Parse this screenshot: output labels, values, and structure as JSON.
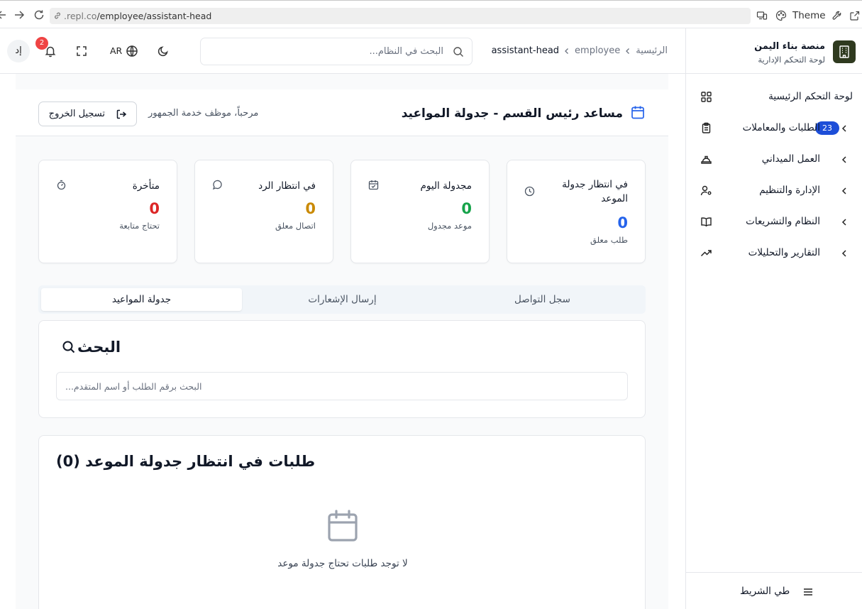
{
  "browser": {
    "url_domain": ".repl.co",
    "url_path": "/employee/assistant-head",
    "theme_label": "Theme"
  },
  "header": {
    "avatar_initials": "إد",
    "notification_count": "2",
    "language": "AR",
    "search_placeholder": "البحث في النظام...",
    "breadcrumb": [
      "الرئيسية",
      "employee",
      "assistant-head"
    ]
  },
  "sidebar": {
    "brand_title": "منصة بناء اليمن",
    "brand_subtitle": "لوحة التحكم الإدارية",
    "items": [
      {
        "label": "لوحة التحكم الرئيسية",
        "icon": "dashboard-grid-icon"
      },
      {
        "label": "الطلبات والمعاملات",
        "icon": "clipboard-icon",
        "badge": "23"
      },
      {
        "label": "العمل الميداني",
        "icon": "hard-hat-icon"
      },
      {
        "label": "الإدارة والتنظيم",
        "icon": "user-cog-icon"
      },
      {
        "label": "النظام والتشريعات",
        "icon": "book-icon"
      },
      {
        "label": "التقارير والتحليلات",
        "icon": "trending-up-icon"
      }
    ],
    "collapse_label": "طي الشريط"
  },
  "page": {
    "title": "مساعد رئيس القسم - جدولة المواعيد",
    "welcome": "مرحباً، موظف خدمة الجمهور",
    "logout_label": "تسجيل الخروج"
  },
  "stats": [
    {
      "title": "في انتظار جدولة الموعد",
      "value": "0",
      "subtitle": "طلب معلق",
      "color": "#2563eb",
      "icon": "clock-icon"
    },
    {
      "title": "مجدولة اليوم",
      "value": "0",
      "subtitle": "موعد مجدول",
      "color": "#16a34a",
      "icon": "calendar-check-icon"
    },
    {
      "title": "في انتظار الرد",
      "value": "0",
      "subtitle": "اتصال معلق",
      "color": "#ca8a04",
      "icon": "message-circle-icon"
    },
    {
      "title": "متأخرة",
      "value": "0",
      "subtitle": "تحتاج متابعة",
      "color": "#dc2626",
      "icon": "timer-icon"
    }
  ],
  "tabs": [
    {
      "label": "جدولة المواعيد",
      "active": true
    },
    {
      "label": "إرسال الإشعارات",
      "active": false
    },
    {
      "label": "سجل التواصل",
      "active": false
    }
  ],
  "search_section": {
    "heading": "البحث",
    "placeholder": "البحث برقم الطلب أو اسم المتقدم..."
  },
  "pending_list": {
    "heading": "طلبات في انتظار جدولة الموعد (0)",
    "empty_text": "لا توجد طلبات تحتاج جدولة موعد"
  }
}
